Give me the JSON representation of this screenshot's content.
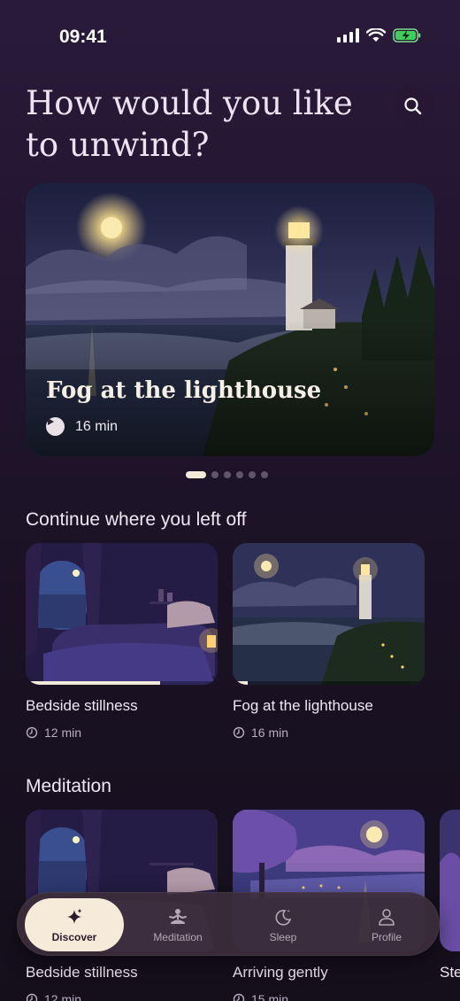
{
  "status_bar": {
    "time": "09:41"
  },
  "header": {
    "title": "How would you like to unwind?"
  },
  "featured": {
    "title": "Fog at the lighthouse",
    "duration": "16 min",
    "page_count": 6,
    "active_page": 1
  },
  "continue_section": {
    "title": "Continue where you left off",
    "items": [
      {
        "title": "Bedside stillness",
        "duration": "12 min",
        "progress": 0.7
      },
      {
        "title": "Fog at the lighthouse",
        "duration": "16 min",
        "progress": 0.08
      }
    ]
  },
  "meditation_section": {
    "title": "Meditation",
    "items": [
      {
        "title": "Bedside stillness",
        "duration": "12 min"
      },
      {
        "title": "Arriving gently",
        "duration": "15 min"
      },
      {
        "title": "Ste"
      }
    ]
  },
  "tab_bar": {
    "tabs": [
      {
        "label": "Discover",
        "icon": "sparkles-icon",
        "active": true
      },
      {
        "label": "Meditation",
        "icon": "meditation-icon",
        "active": false
      },
      {
        "label": "Sleep",
        "icon": "moon-icon",
        "active": false
      },
      {
        "label": "Profile",
        "icon": "person-icon",
        "active": false
      }
    ]
  },
  "colors": {
    "accent": "#f6ebd9",
    "background": "#1a1224"
  }
}
